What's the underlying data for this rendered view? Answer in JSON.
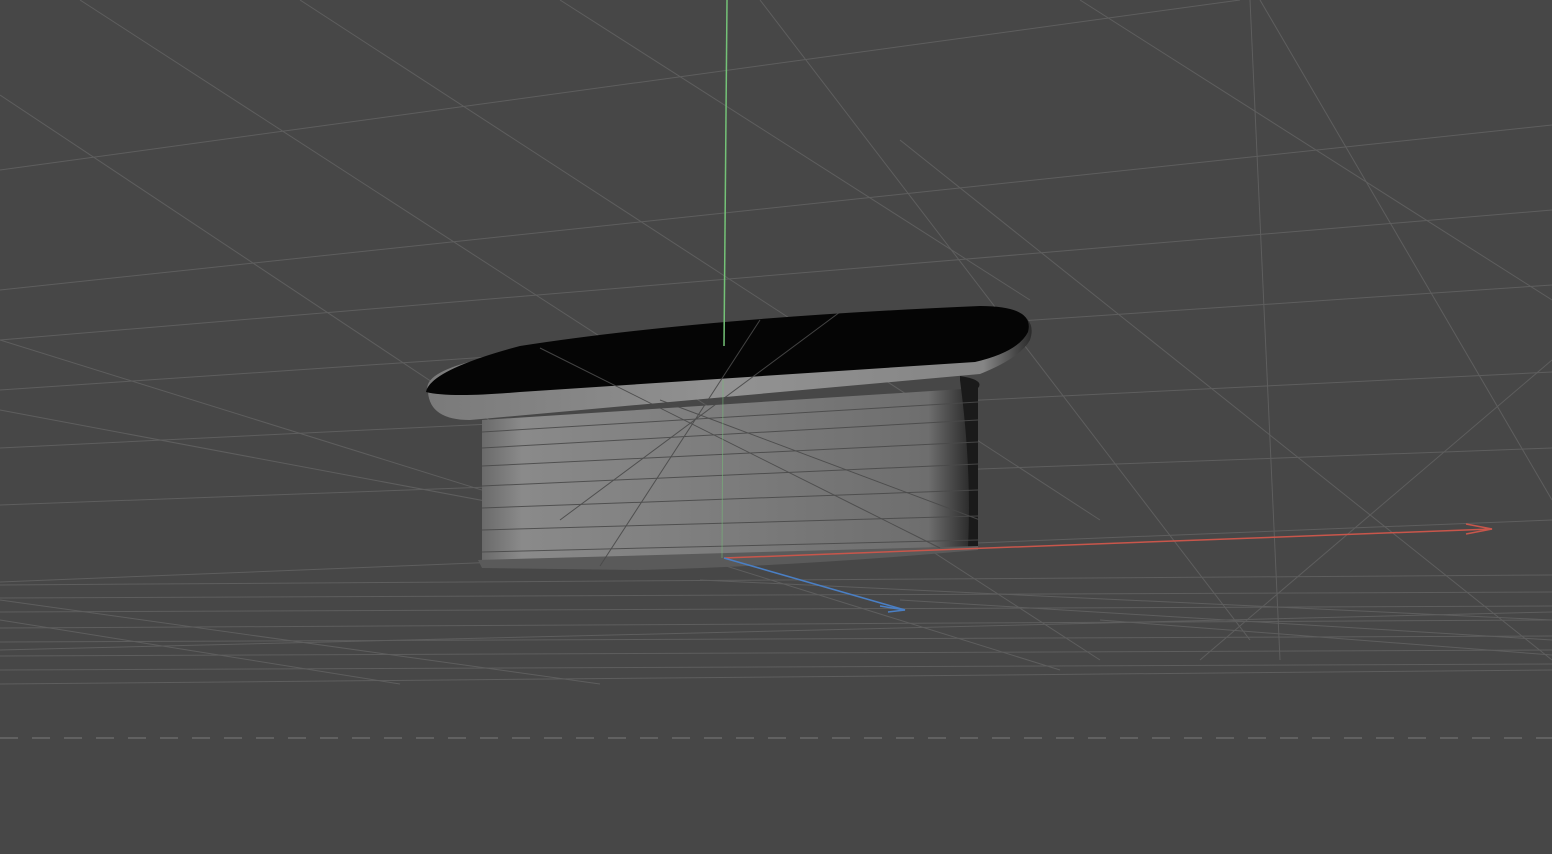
{
  "viewport": {
    "background_color": "#474747",
    "grid_color": "#5e5e5e",
    "horizon_line_color": "#6a6a6a"
  },
  "axes": {
    "x_axis_color": "#c8564b",
    "y_axis_color": "#74c277",
    "z_axis_color": "#4a7fc4"
  },
  "object": {
    "shape": "rounded-slot-extrusion",
    "top_face_color": "#050505",
    "side_face_color": "#7a7a7a",
    "rim_color": "#8c8c8c"
  }
}
